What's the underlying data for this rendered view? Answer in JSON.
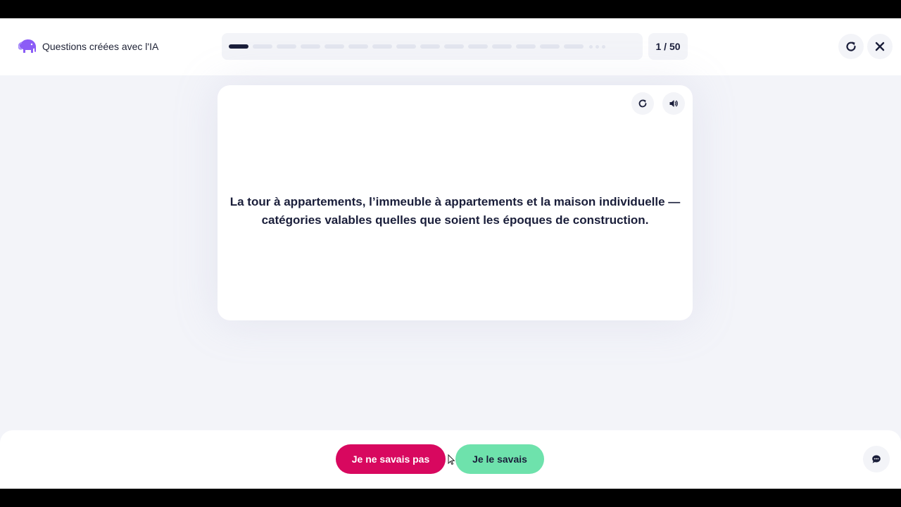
{
  "header": {
    "brand_title": "Questions créées avec l'IA",
    "brand_icon": "elephant-icon",
    "progress": {
      "current": 1,
      "total": 50
    },
    "counter_text": "1 / 50",
    "restart_icon": "restart-icon",
    "close_icon": "close-icon"
  },
  "card": {
    "flip_icon": "refresh-icon",
    "audio_icon": "speaker-icon",
    "text": "La tour à appartements, l’immeuble à appartements et la maison individuelle — catégories valables quelles que soient les époques de construction."
  },
  "footer": {
    "dont_know_label": "Je ne savais pas",
    "know_label": "Je le savais",
    "chat_icon": "chat-icon"
  },
  "colors": {
    "accent_dark": "#1a1e3a",
    "dont_know": "#d8085f",
    "know": "#6ee2ac",
    "brand": "#8b5cf6"
  }
}
